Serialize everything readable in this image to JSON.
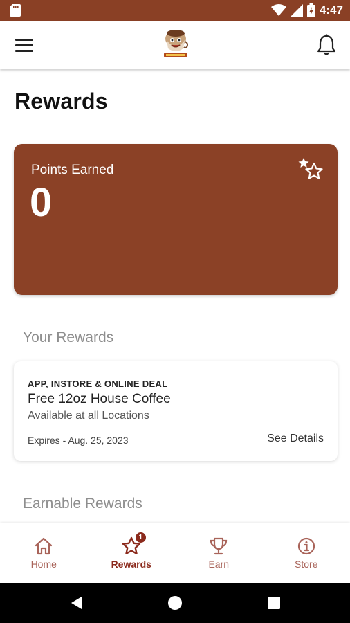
{
  "status_bar": {
    "time": "4:47",
    "icons": [
      "sd-card-icon",
      "wifi-icon",
      "signal-icon",
      "battery-icon"
    ]
  },
  "app_bar": {
    "menu_icon": "hamburger-menu-icon",
    "logo_icon": "coffee-mascot-logo",
    "bell_icon": "bell-icon"
  },
  "page": {
    "title": "Rewards"
  },
  "points_card": {
    "label": "Points Earned",
    "value": "0",
    "icon": "stars-icon",
    "color": "#8b4126"
  },
  "your_rewards": {
    "title": "Your Rewards",
    "items": [
      {
        "tag": "APP, INSTORE & ONLINE DEAL",
        "name": "Free 12oz House Coffee",
        "description": "Available at all Locations",
        "expires": "Expires - Aug. 25, 2023",
        "details_label": "See Details"
      }
    ]
  },
  "earnable_rewards": {
    "title": "Earnable Rewards"
  },
  "bottom_nav": {
    "items": [
      {
        "label": "Home",
        "icon": "home-icon",
        "active": false
      },
      {
        "label": "Rewards",
        "icon": "star-icon",
        "active": true,
        "badge": "1"
      },
      {
        "label": "Earn",
        "icon": "trophy-icon",
        "active": false
      },
      {
        "label": "Store",
        "icon": "info-icon",
        "active": false
      }
    ]
  },
  "colors": {
    "brand": "#8b4126",
    "status_bar": "#8a4025",
    "nav_active": "#8b2a1c",
    "nav_inactive": "#a9645a"
  }
}
